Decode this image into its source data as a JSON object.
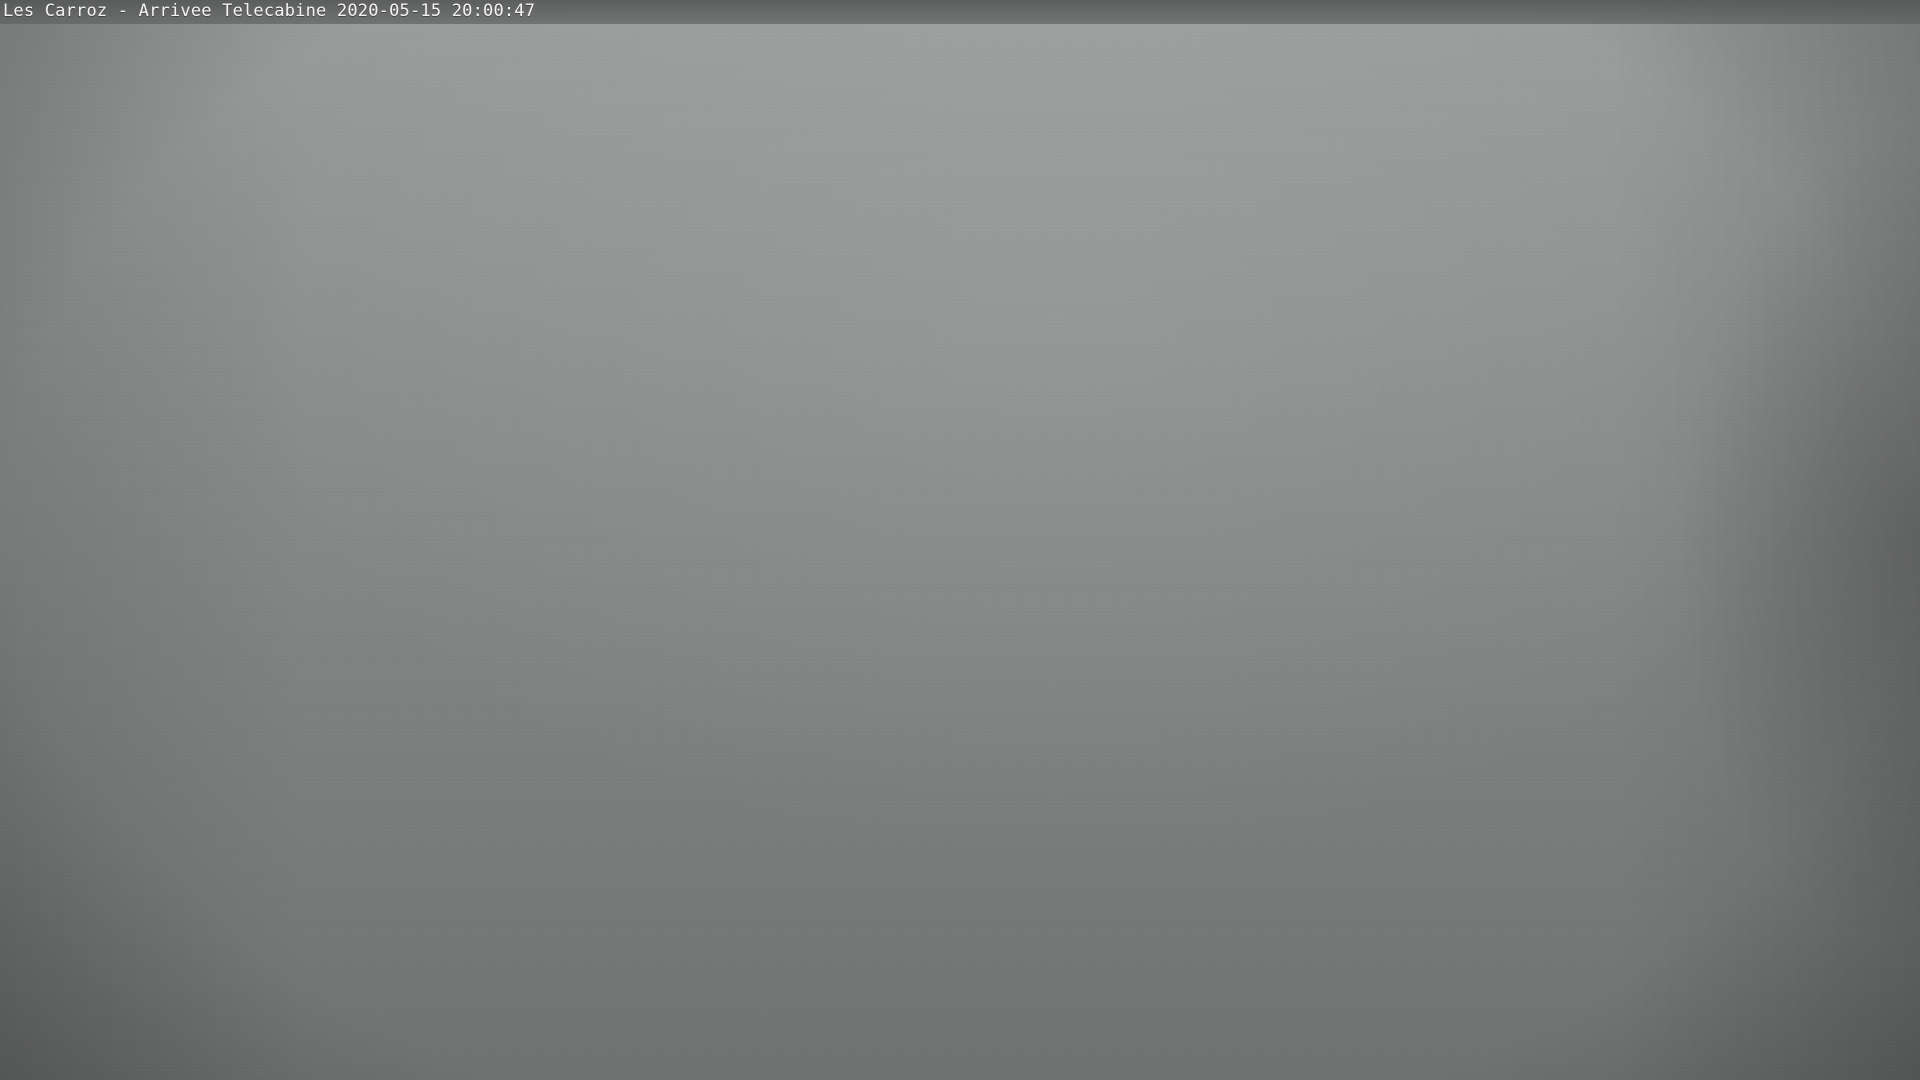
{
  "webcam": {
    "timestamp_caption": "Les Carroz - Arrivee Telecabine 2020-05-15 20:00:47",
    "colors": {
      "sky_light": "#9a9d9c",
      "sky_mid": "#858887",
      "sky_dark": "#6f7271",
      "caption_text": "#f3f3f3"
    }
  }
}
